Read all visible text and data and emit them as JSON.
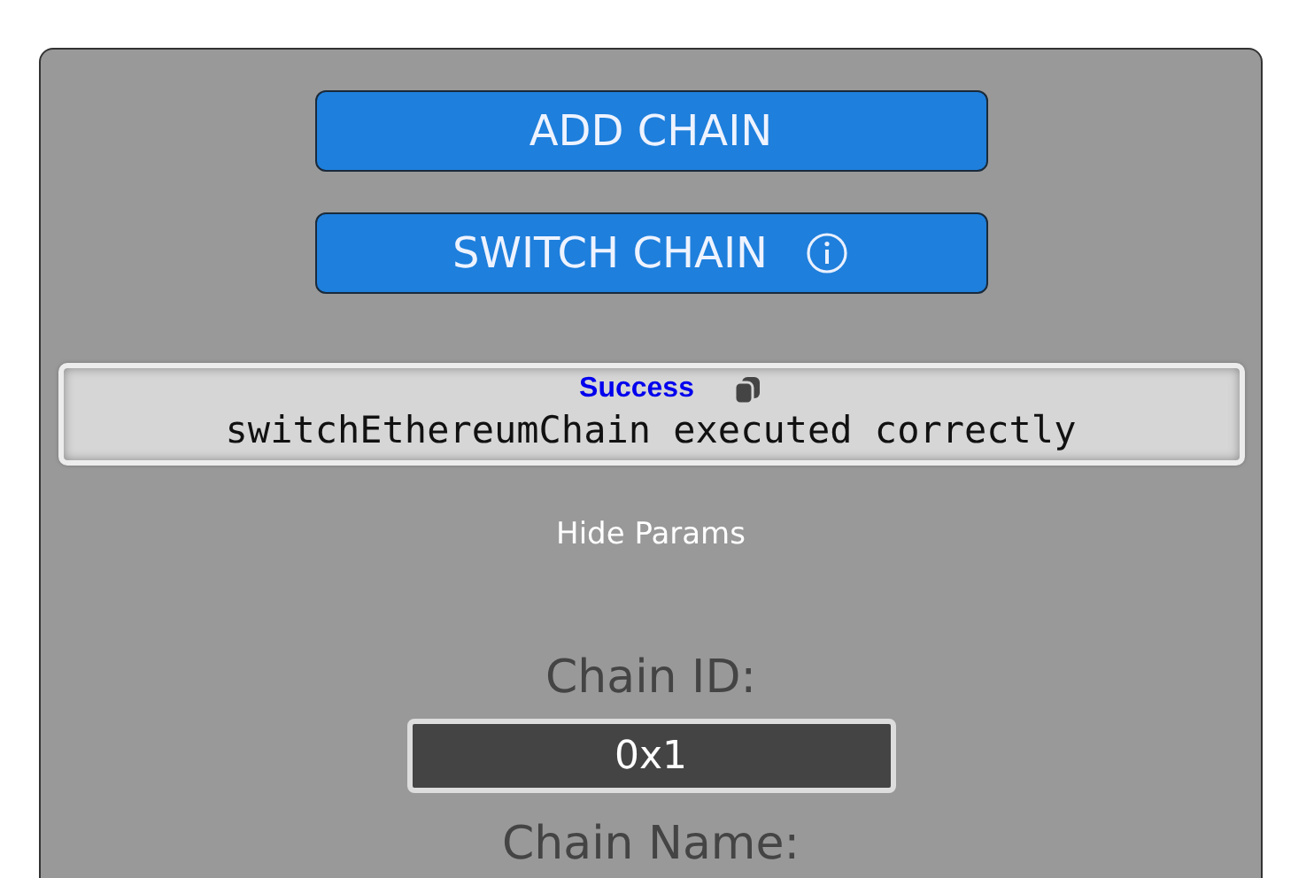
{
  "buttons": [
    {
      "label": "ADD CHAIN",
      "info": false
    },
    {
      "label": "SWITCH CHAIN",
      "info": true
    }
  ],
  "result": {
    "status": "Success",
    "message": "switchEthereumChain executed correctly"
  },
  "toggle_params": "Hide Params",
  "params": [
    {
      "label": "Chain ID:",
      "value": "0x1"
    },
    {
      "label": "Chain Name:"
    }
  ]
}
